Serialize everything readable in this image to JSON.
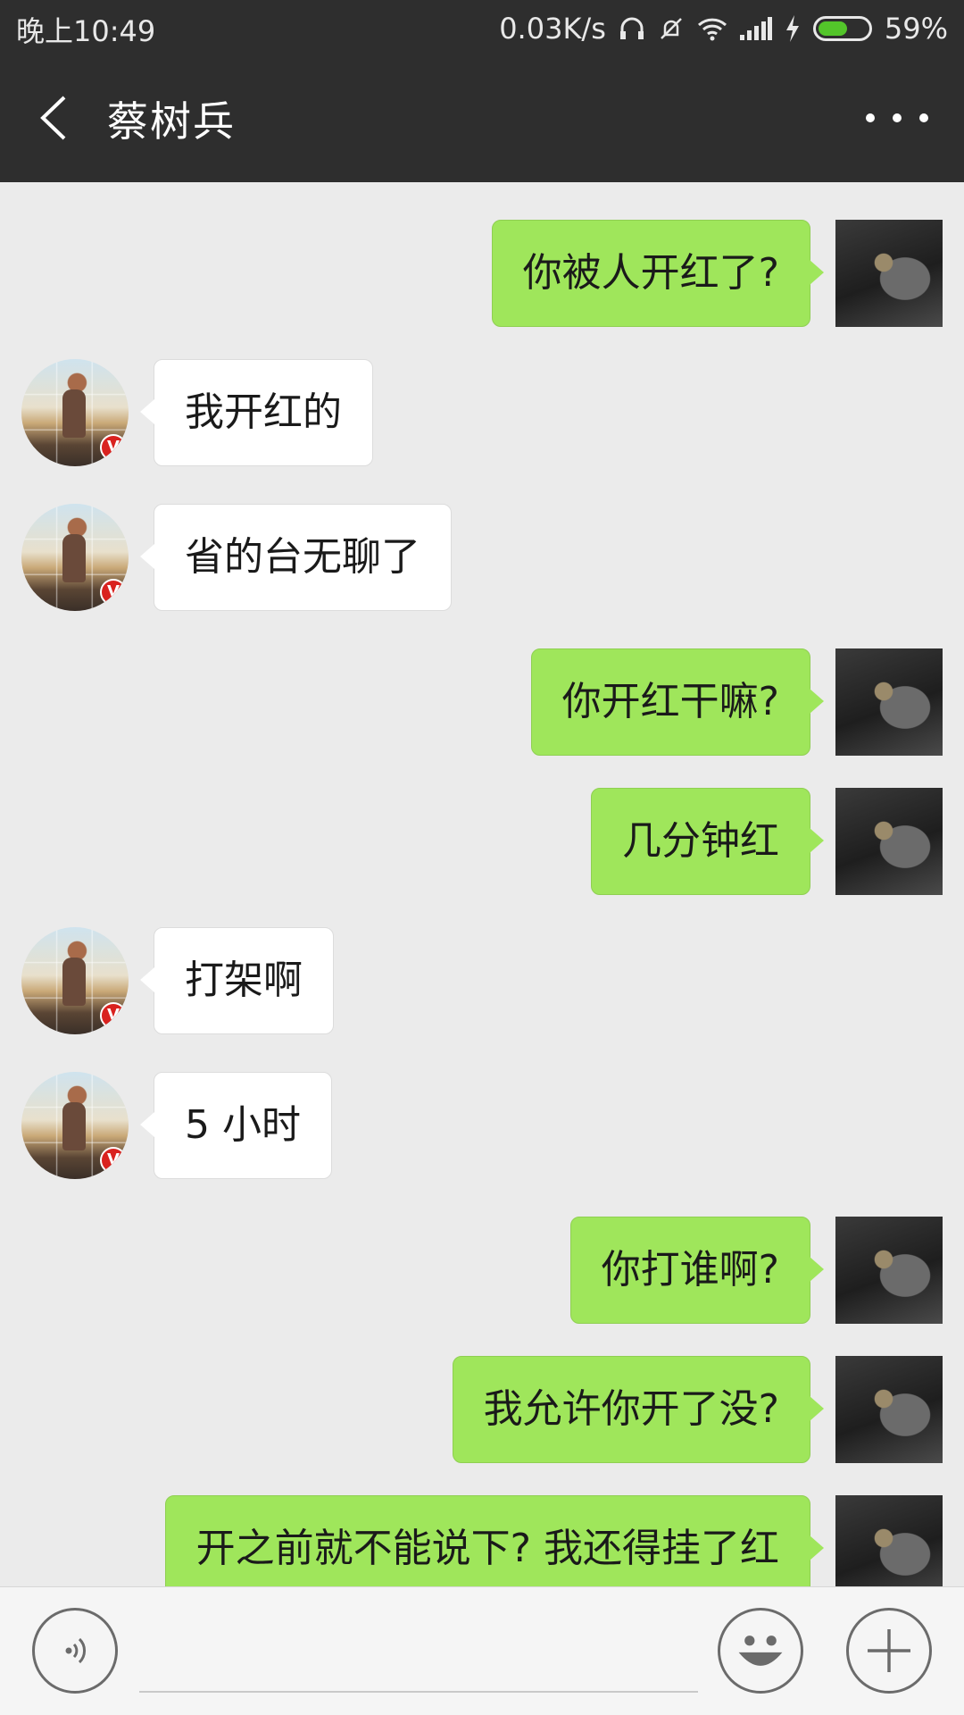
{
  "status_bar": {
    "time": "晚上10:49",
    "network_speed": "0.03K/s",
    "battery_percent": "59%",
    "battery_level": 0.59,
    "icons": [
      "headphones-icon",
      "mute-bell-icon",
      "wifi-icon",
      "signal-icon",
      "charging-icon",
      "battery-icon"
    ]
  },
  "header": {
    "title": "蔡树兵",
    "back_icon": "chevron-left-icon",
    "more_icon": "more-dots-icon"
  },
  "messages": [
    {
      "side": "out",
      "text": "你被人开红了?"
    },
    {
      "side": "in",
      "text": "我开红的"
    },
    {
      "side": "in",
      "text": "省的台无聊了"
    },
    {
      "side": "out",
      "text": "你开红干嘛?"
    },
    {
      "side": "out",
      "text": "几分钟红"
    },
    {
      "side": "in",
      "text": "打架啊"
    },
    {
      "side": "in",
      "text": "5 小时"
    },
    {
      "side": "out",
      "text": "你打谁啊?"
    },
    {
      "side": "out",
      "text": "我允许你开了没?"
    },
    {
      "side": "out",
      "text": "开之前就不能说下? 我还得挂了红"
    }
  ],
  "verified_badge_text": "V",
  "input_bar": {
    "value": "",
    "icons": [
      "voice-icon",
      "emoji-icon",
      "plus-icon"
    ]
  },
  "colors": {
    "header_bg": "#2e2e2e",
    "chat_bg": "#ebebeb",
    "outgoing_bubble": "#9fe65b",
    "incoming_bubble": "#ffffff",
    "battery": "#53c52a",
    "badge": "#d9221f"
  }
}
